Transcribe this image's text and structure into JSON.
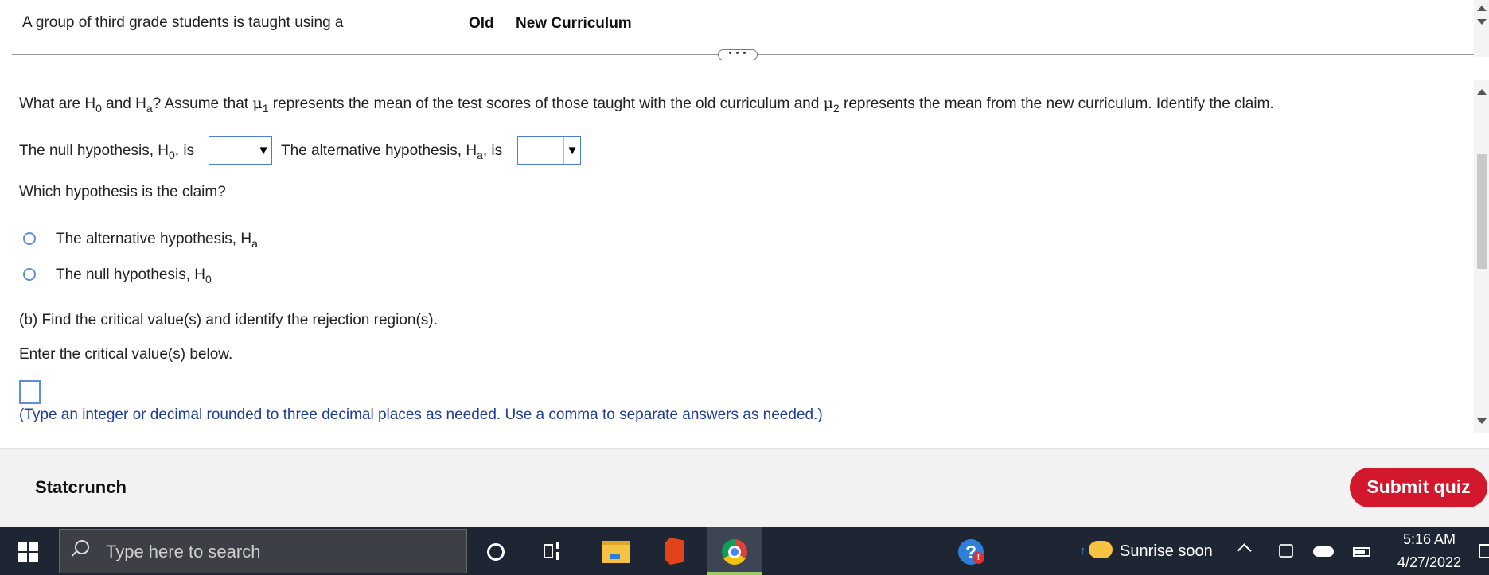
{
  "header": {
    "question_intro": "A group of third grade students is taught using a",
    "col_old": "Old",
    "col_new": "New Curriculum",
    "expander": "• • •"
  },
  "question": {
    "p1_a": "What are H",
    "p1_a_sub": "0",
    "p1_b": " and H",
    "p1_b_sub": "a",
    "p1_c": "? Assume that ",
    "mu": "μ",
    "mu1_sub": "1",
    "p1_d": " represents the mean of the test scores of those taught with the old curriculum and ",
    "mu2_sub": "2",
    "p1_e": " represents the mean from the new curriculum. Identify the claim.",
    "null_label": "The null hypothesis, H",
    "null_sub": "0",
    "null_is": ", is",
    "null_select_value": "",
    "alt_label": "The alternative hypothesis, H",
    "alt_sub": "a",
    "alt_is": ", is",
    "alt_select_value": "",
    "select_arrow": "▼",
    "claim_question": "Which hypothesis is the claim?",
    "options": [
      {
        "label": "The alternative hypothesis, H",
        "sub": "a"
      },
      {
        "label": "The null hypothesis, H",
        "sub": "0"
      }
    ],
    "part_b": "(b) Find the critical value(s) and identify the rejection region(s).",
    "enter_prompt": "Enter the critical value(s) below.",
    "answer_value": "",
    "hint": "(Type an integer or decimal rounded to three decimal places as needed. Use a comma to separate answers as needed.)"
  },
  "footer": {
    "statcrunch": "Statcrunch",
    "submit": "Submit quiz",
    "submit_color": "#d3182d"
  },
  "taskbar": {
    "search_placeholder": "Type here to search",
    "help_glyph": "?",
    "help_badge": "!",
    "weather_text": "Sunrise soon",
    "time": "5:16 AM",
    "date": "4/27/2022"
  }
}
